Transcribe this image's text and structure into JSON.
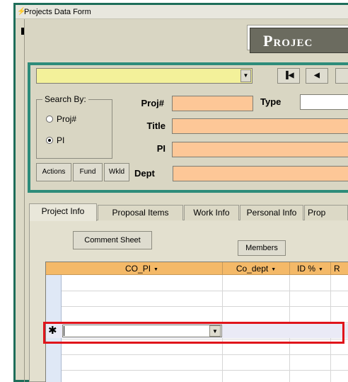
{
  "window": {
    "title": "Projects Data Form"
  },
  "banner": {
    "text": "Projec"
  },
  "search": {
    "combo_value": "",
    "group_label": "Search By:",
    "options": [
      {
        "label": "Proj#",
        "selected": false
      },
      {
        "label": "PI",
        "selected": true
      }
    ]
  },
  "nav": {
    "first": "▐◀",
    "prev": "◀"
  },
  "fields": {
    "proj_label": "Proj#",
    "type_label": "Type",
    "title_label": "Title",
    "pi_label": "PI",
    "dept_label": "Dept",
    "proj_value": "",
    "type_value": "",
    "title_value": "",
    "pi_value": "",
    "dept_value": ""
  },
  "buttons": {
    "actions": "Actions",
    "fund": "Fund",
    "wkld": "Wkld",
    "comment_sheet": "Comment Sheet",
    "members": "Members"
  },
  "tabs": [
    {
      "label": "Project Info",
      "active": true
    },
    {
      "label": "Proposal Items",
      "active": false
    },
    {
      "label": "Work Info",
      "active": false
    },
    {
      "label": "Personal Info",
      "active": false
    },
    {
      "label": "Prop",
      "active": false
    }
  ],
  "datasheet": {
    "columns": [
      "CO_PI",
      "Co_dept",
      "ID %",
      "R"
    ],
    "new_row_marker": "✱",
    "new_row_value": ""
  },
  "colors": {
    "input_orange": "#fdc797",
    "combo_yellow": "#f3f19a",
    "frame_teal": "#2e8c7a",
    "header_orange": "#f4b968",
    "highlight_red": "#e0141b"
  }
}
